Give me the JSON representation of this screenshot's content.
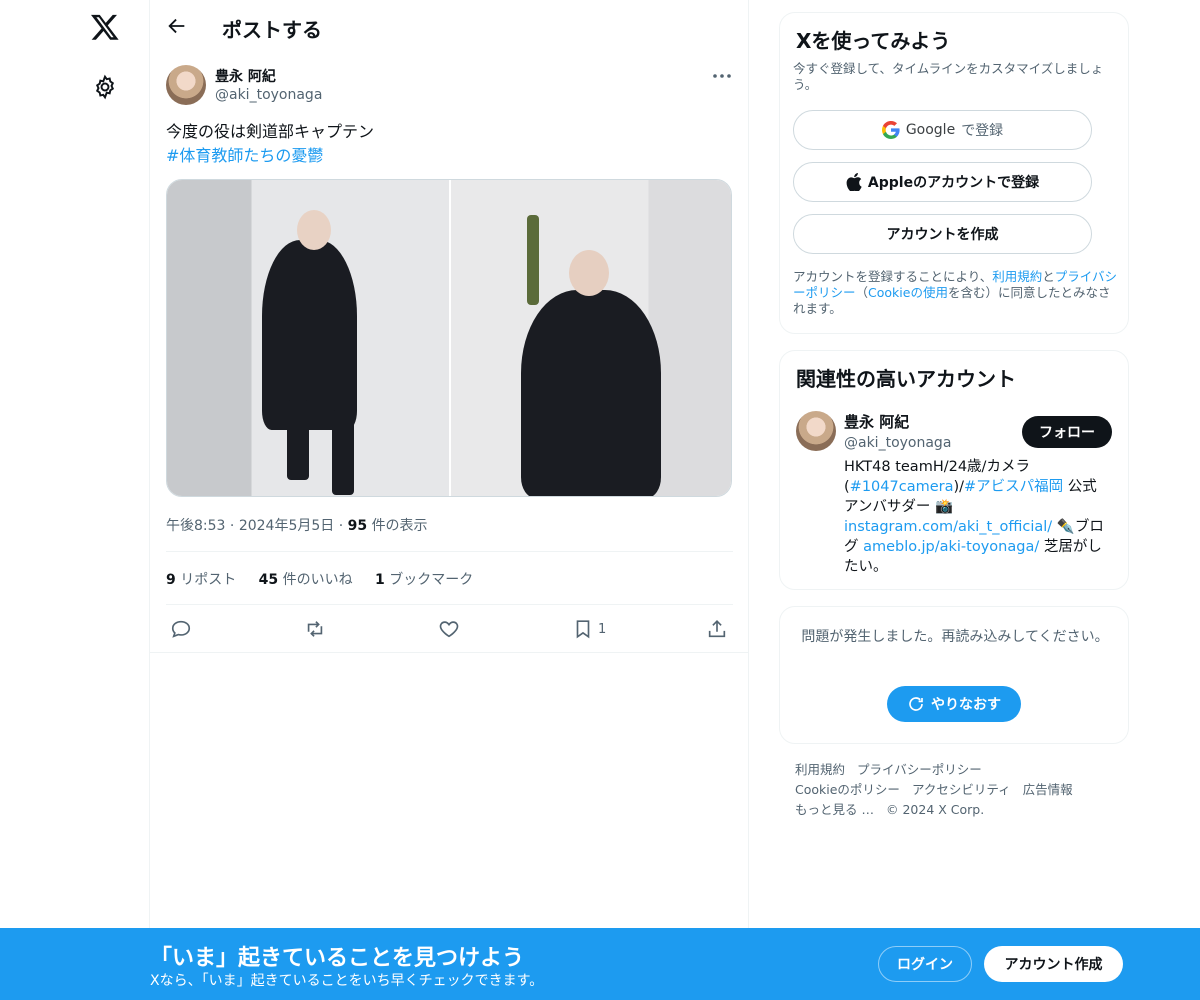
{
  "header": {
    "title": "ポストする"
  },
  "post": {
    "author_name": "豊永 阿紀",
    "author_handle": "@aki_toyonaga",
    "text": "今度の役は剣道部キャプテン",
    "hashtag": "#体育教師たちの憂鬱",
    "time": "午後8:53",
    "date": "2024年5月5日",
    "sep": "·",
    "views_count": "95",
    "views_label": "件の表示",
    "reposts_count": "9",
    "reposts_label": "リポスト",
    "likes_count": "45",
    "likes_label": "件のいいね",
    "bookmarks_count": "1",
    "bookmarks_label": "ブックマーク",
    "bookmark_action_count": "1"
  },
  "signup": {
    "title": "Xを使ってみよう",
    "subtitle": "今すぐ登録して、タイムラインをカスタマイズしましょう。",
    "google_label": "Google",
    "google_suffix": "で登録",
    "apple_label": "Appleのアカウントで登録",
    "create_label": "アカウントを作成",
    "terms_1": "アカウントを登録することにより、",
    "terms_link1": "利用規約",
    "terms_2": "と",
    "terms_link2": "プライバシーポリシー",
    "terms_3": "（",
    "terms_link3": "Cookieの使用",
    "terms_4": "を含む）に同意したとみなされます。"
  },
  "related": {
    "title": "関連性の高いアカウント",
    "name": "豊永 阿紀",
    "handle": "@aki_toyonaga",
    "follow_label": "フォロー",
    "bio_1": "HKT48 teamH/24歳/カメラ(",
    "bio_link1": "#1047camera",
    "bio_2": ")/",
    "bio_link2": "#アビスパ福岡",
    "bio_3": " 公式アンバサダー 📸",
    "bio_link3": "instagram.com/aki_t_official/",
    "bio_4": " ✒️ブログ ",
    "bio_link4": "ameblo.jp/aki-toyonaga/",
    "bio_5": " 芝居がしたい。"
  },
  "error": {
    "message": "問題が発生しました。再読み込みしてください。",
    "retry_label": "やりなおす"
  },
  "footer": {
    "links": [
      "利用規約",
      "プライバシーポリシー",
      "Cookieのポリシー",
      "アクセシビリティ",
      "広告情報",
      "もっと見る …",
      "© 2024 X Corp."
    ]
  },
  "banner": {
    "title": "「いま」起きていることを見つけよう",
    "subtitle": "Xなら、「いま」起きていることをいち早くチェックできます。",
    "login_label": "ログイン",
    "create_label": "アカウント作成"
  },
  "colors": {
    "accent": "#1d9bf0",
    "text": "#0f1419",
    "muted": "#536471",
    "border": "#eff3f4"
  }
}
